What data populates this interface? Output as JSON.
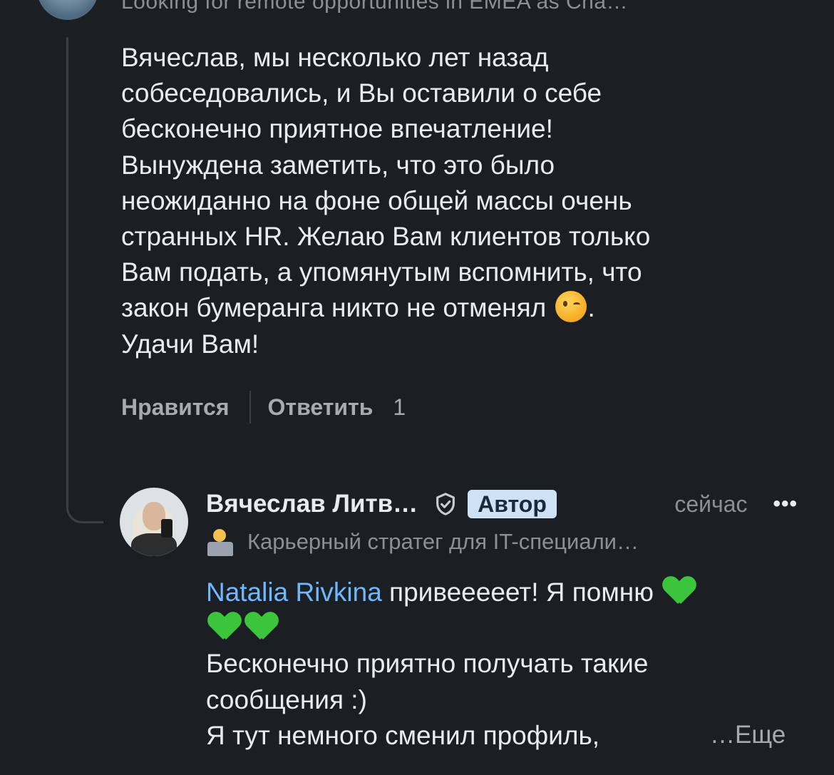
{
  "parent_comment": {
    "headline": "Looking for remote opportunities in EMEA as Cha…",
    "body_lines": [
      "Вячеслав, мы несколько лет назад",
      "собеседовались, и Вы оставили о себе",
      "бесконечно приятное впечатление!",
      "Вынуждена заметить, что это было",
      "неожиданно на фоне общей массы очень",
      "странных HR. Желаю Вам клиентов только",
      "Вам подать, а упомянутым вспомнить, что",
      "закон бумеранга никто не отменял",
      "Удачи Вам!"
    ],
    "line8_suffix": ".",
    "like_label": "Нравится",
    "reply_label": "Ответить",
    "reply_count": "1"
  },
  "reply": {
    "author_name": "Вячеслав Литв…",
    "author_badge": "Автор",
    "time": "сейчас",
    "more_icon": "•••",
    "subtitle": "Карьерный стратег для IT-специали…",
    "mention": "Natalia Rivkina",
    "line1_text": " привееееет! Я помню ",
    "line3": "Бесконечно приятно получать такие",
    "line4": "сообщения :)",
    "line5": "Я тут немного сменил профиль,",
    "more_link": "…Еще"
  },
  "icons": {
    "parent_avatar": "avatar",
    "wink": "winking-face-emoji",
    "verified": "shield-check-icon",
    "laptop_person": "technologist-emoji",
    "heart": "green-heart-emoji"
  }
}
